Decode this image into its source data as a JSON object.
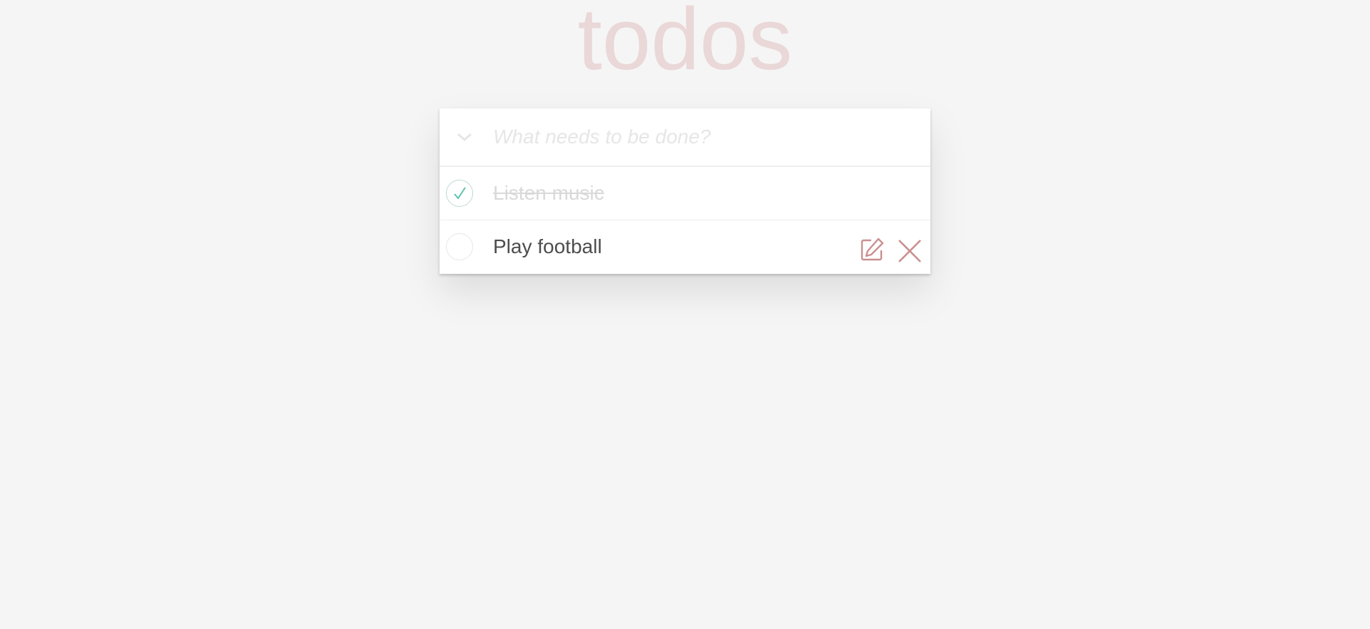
{
  "app": {
    "title": "todos"
  },
  "new_todo": {
    "value": "",
    "placeholder": "What needs to be done?"
  },
  "todos": [
    {
      "label": "Listen music",
      "completed": true
    },
    {
      "label": "Play football",
      "completed": false
    }
  ],
  "icons": {
    "toggle_all": "chevron-down-icon",
    "check": "checkmark-icon",
    "edit": "edit-icon",
    "delete": "close-icon"
  },
  "colors": {
    "background": "#f5f5f5",
    "title": "#efd5d5",
    "check": "#5dc2af",
    "action_icon": "#c9908f",
    "completed_text": "#d9d9d9",
    "text": "#4d4d4d"
  }
}
